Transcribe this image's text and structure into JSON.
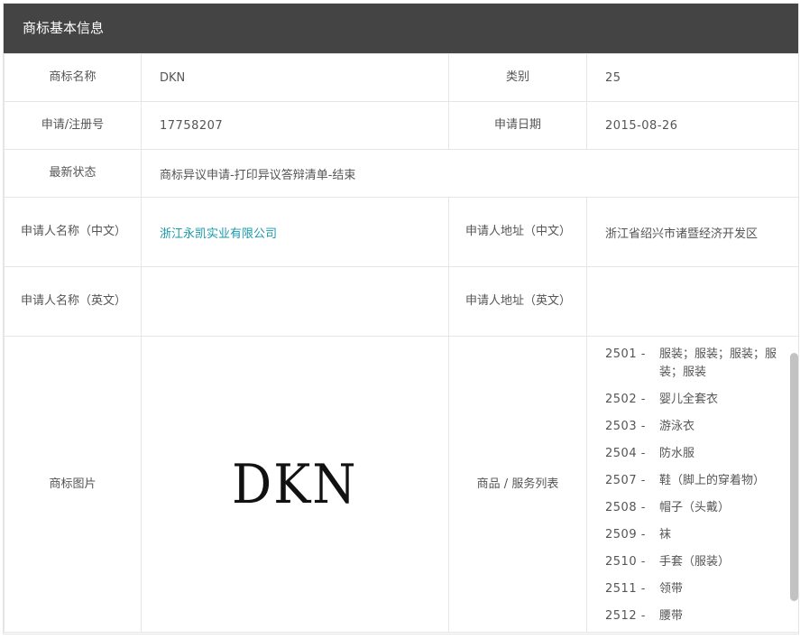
{
  "panel": {
    "title": "商标基本信息"
  },
  "labels": {
    "name": "商标名称",
    "category": "类别",
    "reg_no": "申请/注册号",
    "apply_date": "申请日期",
    "status": "最新状态",
    "applicant_cn": "申请人名称（中文）",
    "address_cn": "申请人地址（中文）",
    "applicant_en": "申请人名称（英文）",
    "address_en": "申请人地址（英文）",
    "image": "商标图片",
    "goods": "商品 / 服务列表"
  },
  "values": {
    "name": "DKN",
    "category": "25",
    "reg_no": "17758207",
    "apply_date": "2015-08-26",
    "status": "商标异议申请-打印异议答辩清单-结束",
    "applicant_cn": "浙江永凯实业有限公司",
    "address_cn": "浙江省绍兴市诸暨经济开发区",
    "applicant_en": "",
    "address_en": "",
    "logo_text": "DKN"
  },
  "goods": [
    {
      "code": "2501 -",
      "name": "服装；服装；服装；服装；服装"
    },
    {
      "code": "2502 -",
      "name": "婴儿全套衣"
    },
    {
      "code": "2503 -",
      "name": "游泳衣"
    },
    {
      "code": "2504 -",
      "name": "防水服"
    },
    {
      "code": "2507 -",
      "name": "鞋（脚上的穿着物）"
    },
    {
      "code": "2508 -",
      "name": "帽子（头戴）"
    },
    {
      "code": "2509 -",
      "name": "袜"
    },
    {
      "code": "2510 -",
      "name": "手套（服装）"
    },
    {
      "code": "2511 -",
      "name": "领带"
    },
    {
      "code": "2512 -",
      "name": "腰带"
    }
  ],
  "colors": {
    "header_bg": "#444444",
    "link": "#1a99aa",
    "border": "#e6e6e6"
  }
}
